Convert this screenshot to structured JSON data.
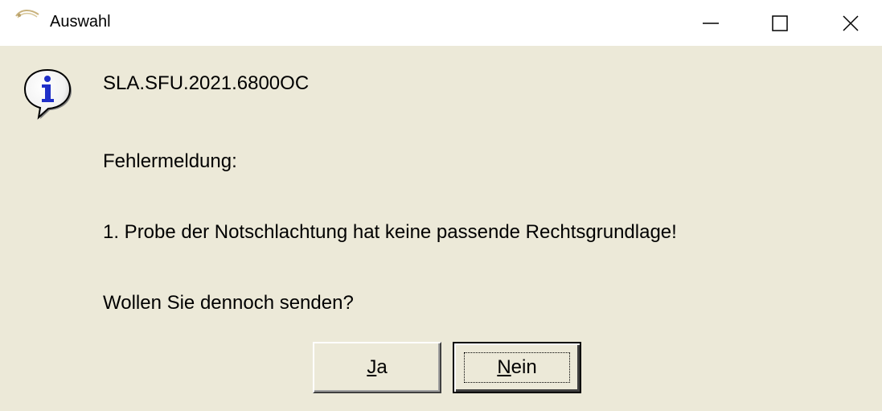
{
  "window": {
    "title": "Auswahl",
    "controls": {
      "minimize_icon": "minimize-icon",
      "maximize_icon": "maximize-icon",
      "close_icon": "close-icon"
    }
  },
  "dialog": {
    "icon": "info-icon",
    "code": "SLA.SFU.2021.6800OC",
    "error_heading": "Fehlermeldung:",
    "error_message": "1. Probe der Notschlachtung hat keine passende Rechtsgrundlage!",
    "question": "Wollen Sie dennoch senden?",
    "buttons": {
      "yes": {
        "mnemonic": "J",
        "rest": "a"
      },
      "no": {
        "mnemonic": "N",
        "rest": "ein"
      }
    }
  },
  "colors": {
    "dialog_background": "#ece9d8",
    "titlebar_background": "#ffffff",
    "info_icon_blue": "#1f2fc8"
  }
}
